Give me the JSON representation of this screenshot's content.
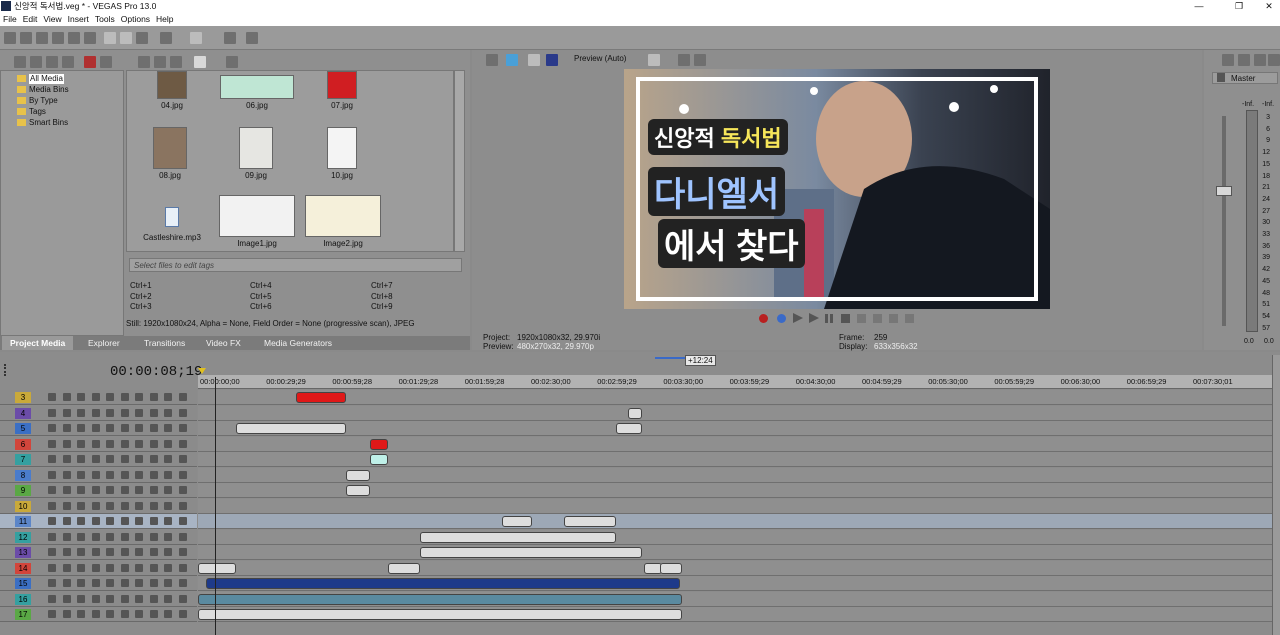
{
  "window": {
    "title": "신앙적 독서법.veg * - VEGAS Pro 13.0",
    "controls": [
      "—",
      "❐",
      "✕"
    ]
  },
  "menu": [
    "File",
    "Edit",
    "View",
    "Insert",
    "Tools",
    "Options",
    "Help"
  ],
  "explorer": {
    "tree": [
      "All Media",
      "Media Bins",
      "By Type",
      "Tags",
      "Smart Bins"
    ],
    "files": [
      "04.jpg",
      "06.jpg",
      "07.jpg",
      "08.jpg",
      "09.jpg",
      "10.jpg",
      "Castleshire.mp3",
      "Image1.jpg",
      "Image2.jpg"
    ],
    "tag_placeholder": "Select files to edit tags",
    "shortcuts": [
      "Ctrl+1",
      "Ctrl+4",
      "Ctrl+7",
      "Ctrl+2",
      "Ctrl+5",
      "Ctrl+8",
      "Ctrl+3",
      "Ctrl+6",
      "Ctrl+9"
    ],
    "file_info": "Still: 1920x1080x24, Alpha = None, Field Order = None (progressive scan), JPEG"
  },
  "tabs": [
    "Project Media",
    "Explorer",
    "Transitions",
    "Video FX",
    "Media Generators"
  ],
  "preview": {
    "mode": "Preview (Auto)",
    "overlay_line1a": "신앙적 ",
    "overlay_line1b": "독서법",
    "overlay_line2": "다니엘서",
    "overlay_line3": "에서 찾다",
    "project_label": "Project:",
    "project_value": "1920x1080x32, 29.970i",
    "preview_label": "Preview:",
    "preview_value": "480x270x32, 29.970p",
    "frame_label": "Frame:",
    "frame_value": "259",
    "display_label": "Display:",
    "display_value": "633x356x32"
  },
  "mixer": {
    "title": "Master",
    "inf_left": "-Inf.",
    "inf_right": "-Inf.",
    "scale": [
      "3",
      "6",
      "9",
      "12",
      "15",
      "18",
      "21",
      "24",
      "27",
      "30",
      "33",
      "36",
      "39",
      "42",
      "45",
      "48",
      "51",
      "54",
      "57"
    ],
    "bottom_left": "0.0",
    "bottom_right": "0.0"
  },
  "timeline": {
    "timecode": "00:00:08;19",
    "region_label": "+12:24",
    "ruler": [
      "00:00:00;00",
      "00:00:29;29",
      "00:00:59;28",
      "00:01:29;28",
      "00:01:59;28",
      "00:02:30;00",
      "00:02:59;29",
      "00:03:30;00",
      "00:03:59;29",
      "00:04:30;00",
      "00:04:59;29",
      "00:05:30;00",
      "00:05:59;29",
      "00:06:30;00",
      "00:06:59;29",
      "00:07:30;01"
    ],
    "tracks": [
      {
        "num": "3",
        "color": "#c9a93a"
      },
      {
        "num": "4",
        "color": "#6b4ca8"
      },
      {
        "num": "5",
        "color": "#3b6fc4"
      },
      {
        "num": "6",
        "color": "#d2453b"
      },
      {
        "num": "7",
        "color": "#35a0a0"
      },
      {
        "num": "8",
        "color": "#4a7ccc"
      },
      {
        "num": "9",
        "color": "#5aa845"
      },
      {
        "num": "10",
        "color": "#c9a93a"
      },
      {
        "num": "11",
        "color": "#5c86c8"
      },
      {
        "num": "12",
        "color": "#35a0a0"
      },
      {
        "num": "13",
        "color": "#6b4ca8"
      },
      {
        "num": "14",
        "color": "#d2453b"
      },
      {
        "num": "15",
        "color": "#3b6fc4"
      },
      {
        "num": "16",
        "color": "#35a0a0"
      },
      {
        "num": "17",
        "color": "#5aa845"
      }
    ]
  }
}
